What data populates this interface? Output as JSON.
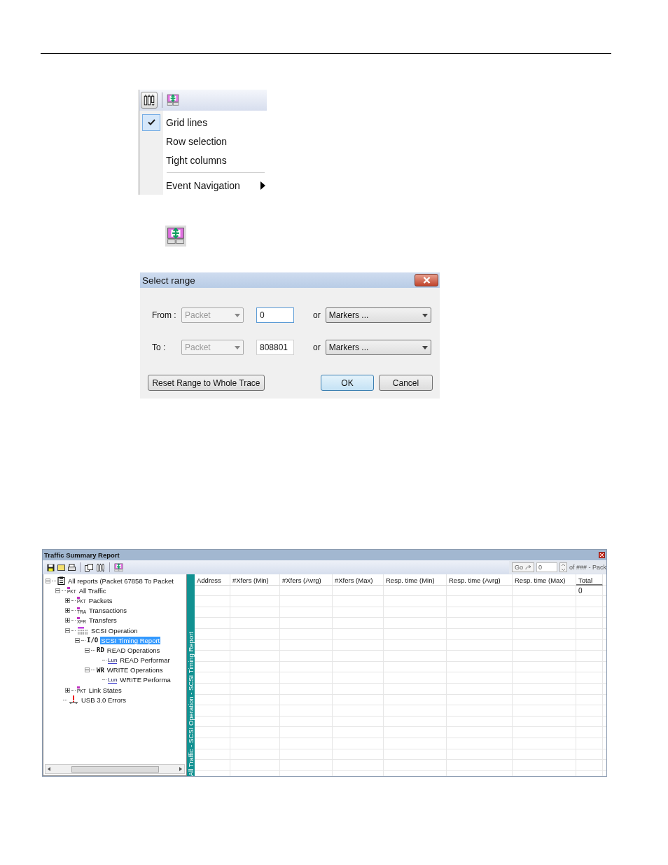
{
  "menu": {
    "items": [
      {
        "kind": "check",
        "label": "Grid lines",
        "checked": true
      },
      {
        "kind": "check",
        "label": "Row selection",
        "checked": false
      },
      {
        "kind": "check",
        "label": "Tight columns",
        "checked": false
      },
      {
        "kind": "separator"
      },
      {
        "kind": "submenu",
        "label": "Event Navigation"
      }
    ]
  },
  "dialog": {
    "title": "Select range",
    "rows": [
      {
        "label": "From :",
        "unit": "Packet",
        "unit_disabled": true,
        "value": "0",
        "focused": true,
        "or": "or",
        "marker": "Markers ..."
      },
      {
        "label": "To :",
        "unit": "Packet",
        "unit_disabled": true,
        "value": "808801",
        "focused": false,
        "or": "or",
        "marker": "Markers ..."
      }
    ],
    "buttons": [
      {
        "label": "Reset Range to Whole Trace",
        "default": false
      },
      {
        "label": "OK",
        "default": true
      },
      {
        "label": "Cancel",
        "default": false
      }
    ]
  },
  "report": {
    "title": "Traffic Summary Report",
    "goto": {
      "button": "Go",
      "value": "0",
      "suffix": "of ### - Pack"
    },
    "tree": [
      {
        "kind": "report",
        "label": "All reports (Packet 67858 To Packet",
        "expanded": true,
        "selected": false,
        "children": [
          {
            "kind": "tag",
            "icon_text": "PKT",
            "label": "All Traffic",
            "expanded": true,
            "selected": false,
            "children": [
              {
                "kind": "tag",
                "icon_text": "PKT",
                "label": "Packets",
                "expanded": false,
                "selected": false
              },
              {
                "kind": "tag",
                "icon_text": "TRA",
                "label": "Transactions",
                "expanded": false,
                "selected": false
              },
              {
                "kind": "tag",
                "icon_text": "XFR",
                "label": "Transfers",
                "expanded": false,
                "selected": false
              },
              {
                "kind": "scsi",
                "label": "SCSI Operation",
                "expanded": true,
                "selected": false,
                "children": [
                  {
                    "kind": "bold",
                    "icon_text": "I/O",
                    "label": "SCSI Timing Report",
                    "expanded": true,
                    "selected": true,
                    "children": [
                      {
                        "kind": "bold",
                        "icon_text": "RD",
                        "label": "READ Operations",
                        "expanded": true,
                        "selected": false,
                        "children": [
                          {
                            "kind": "lun",
                            "icon_text": "Lun",
                            "label": "READ Performar",
                            "selected": false
                          }
                        ]
                      },
                      {
                        "kind": "bold",
                        "icon_text": "WR",
                        "label": "WRITE Operations",
                        "expanded": true,
                        "selected": false,
                        "children": [
                          {
                            "kind": "lun",
                            "icon_text": "Lun",
                            "label": "WRITE Performa",
                            "selected": false
                          }
                        ]
                      }
                    ]
                  }
                ]
              },
              {
                "kind": "tag",
                "icon_text": "PKT",
                "label": "Link States",
                "expanded": false,
                "selected": false
              }
            ]
          },
          {
            "kind": "error",
            "label": "USB 3.0 Errors",
            "selected": false
          }
        ]
      }
    ],
    "path": "All Traffic - SCSI Operation - SCSI Timing Report",
    "columns": [
      "Address",
      "#Xfers (Min)",
      "#Xfers (Avrg)",
      "#Xfers (Max)",
      "Resp. time (Min)",
      "Resp. time (Avrg)",
      "Resp. time (Max)",
      "Total"
    ],
    "rows": [
      {
        "total": "0"
      }
    ]
  }
}
